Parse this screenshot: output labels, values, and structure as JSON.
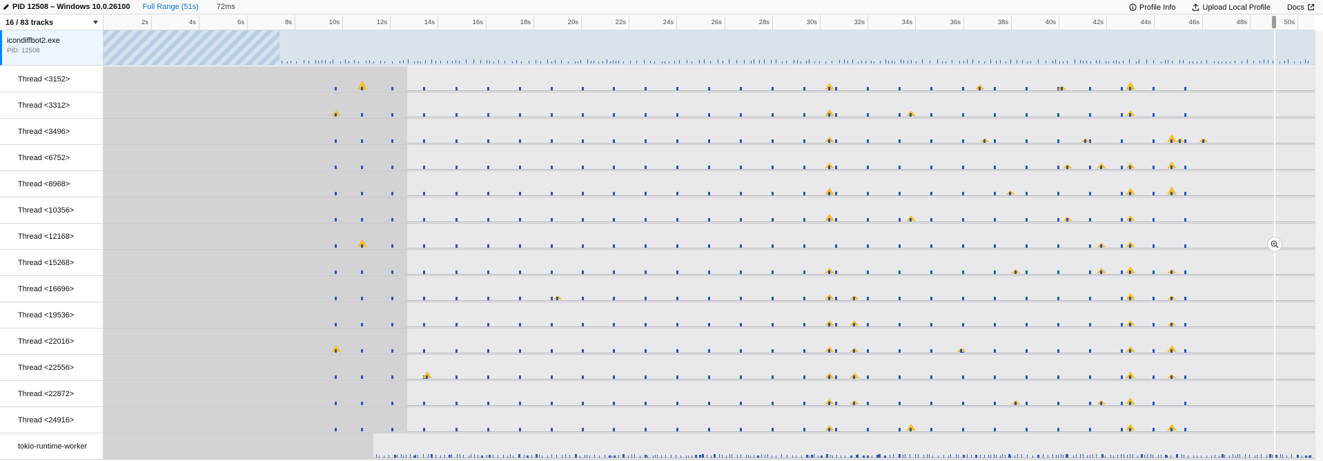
{
  "header": {
    "title": "PID 12508 – Windows 10.0.26100",
    "range_label": "Full Range (51s)",
    "selection_duration": "72ms",
    "profile_info_label": "Profile Info",
    "upload_label": "Upload Local Profile",
    "docs_label": "Docs"
  },
  "timeline": {
    "track_count": "16 / 83 tracks",
    "ticks": [
      "2s",
      "4s",
      "6s",
      "8s",
      "10s",
      "12s",
      "14s",
      "16s",
      "18s",
      "20s",
      "22s",
      "24s",
      "26s",
      "28s",
      "30s",
      "32s",
      "34s",
      "36s",
      "38s",
      "40s",
      "42s",
      "44s",
      "46s",
      "48s",
      "50s"
    ]
  },
  "process": {
    "name": "icondiffbot2.exe",
    "pid_label": "PID: 12508"
  },
  "threads": [
    {
      "name": "Thread <3152>"
    },
    {
      "name": "Thread <3312>"
    },
    {
      "name": "Thread <3496>"
    },
    {
      "name": "Thread <6752>"
    },
    {
      "name": "Thread <8968>"
    },
    {
      "name": "Thread <10356>"
    },
    {
      "name": "Thread <12168>"
    },
    {
      "name": "Thread <15268>"
    },
    {
      "name": "Thread <16696>"
    },
    {
      "name": "Thread <19536>"
    },
    {
      "name": "Thread <22016>"
    },
    {
      "name": "Thread <22556>"
    },
    {
      "name": "Thread <22872>"
    },
    {
      "name": "Thread <24916>"
    },
    {
      "name": "tokio-runtime-worker"
    }
  ],
  "colors": {
    "accent": "#0a84ff",
    "sample_marker": "#2a55b5",
    "cpu_fill": "#f2c12e",
    "inactive": "#d3d3d6"
  }
}
